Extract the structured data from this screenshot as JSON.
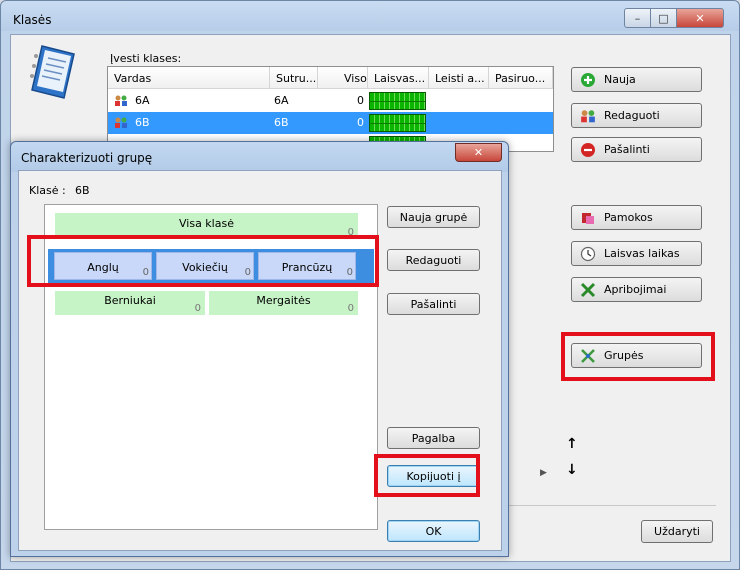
{
  "window": {
    "title": "Klasės",
    "controls": {
      "minimize": "–",
      "maximize": "□",
      "close": "✕"
    }
  },
  "classes": {
    "label": "Įvesti klases:",
    "columns": [
      "Vardas",
      "Sutru...",
      "Viso",
      "Laisvas...",
      "Leisti a...",
      "Pasiruo..."
    ],
    "rows": [
      {
        "name": "6A",
        "short": "6A",
        "total": "0",
        "selected": false
      },
      {
        "name": "6B",
        "short": "6B",
        "total": "0",
        "selected": true
      }
    ]
  },
  "side_buttons": {
    "new": "Nauja",
    "edit": "Redaguoti",
    "delete": "Pašalinti",
    "lessons": "Pamokos",
    "free_time": "Laisvas laikas",
    "constraints": "Apribojimai",
    "groups": "Grupės"
  },
  "bottom": {
    "close": "Uždaryti",
    "arrow_up": "↑",
    "arrow_down": "↓"
  },
  "dialog": {
    "title": "Charakterizuoti grupę",
    "close": "✕",
    "class_label": "Klasė :",
    "class_value": "6B",
    "whole_class": {
      "label": "Visa klasė",
      "count": "0"
    },
    "language_groups": [
      {
        "label": "Anglų",
        "count": "0"
      },
      {
        "label": "Vokiečių",
        "count": "0"
      },
      {
        "label": "Prancūzų",
        "count": "0"
      }
    ],
    "gender_groups": [
      {
        "label": "Berniukai",
        "count": "0"
      },
      {
        "label": "Mergaitės",
        "count": "0"
      }
    ],
    "buttons": {
      "new_group": "Nauja grupė",
      "edit": "Redaguoti",
      "delete": "Pašalinti",
      "help": "Pagalba",
      "copy_to": "Kopijuoti į",
      "ok": "OK"
    }
  },
  "colors": {
    "highlight_red": "#e3101b",
    "selection_blue": "#3399ff",
    "group_green": "#c7f4c7",
    "group_blue": "#c9d8f8"
  }
}
